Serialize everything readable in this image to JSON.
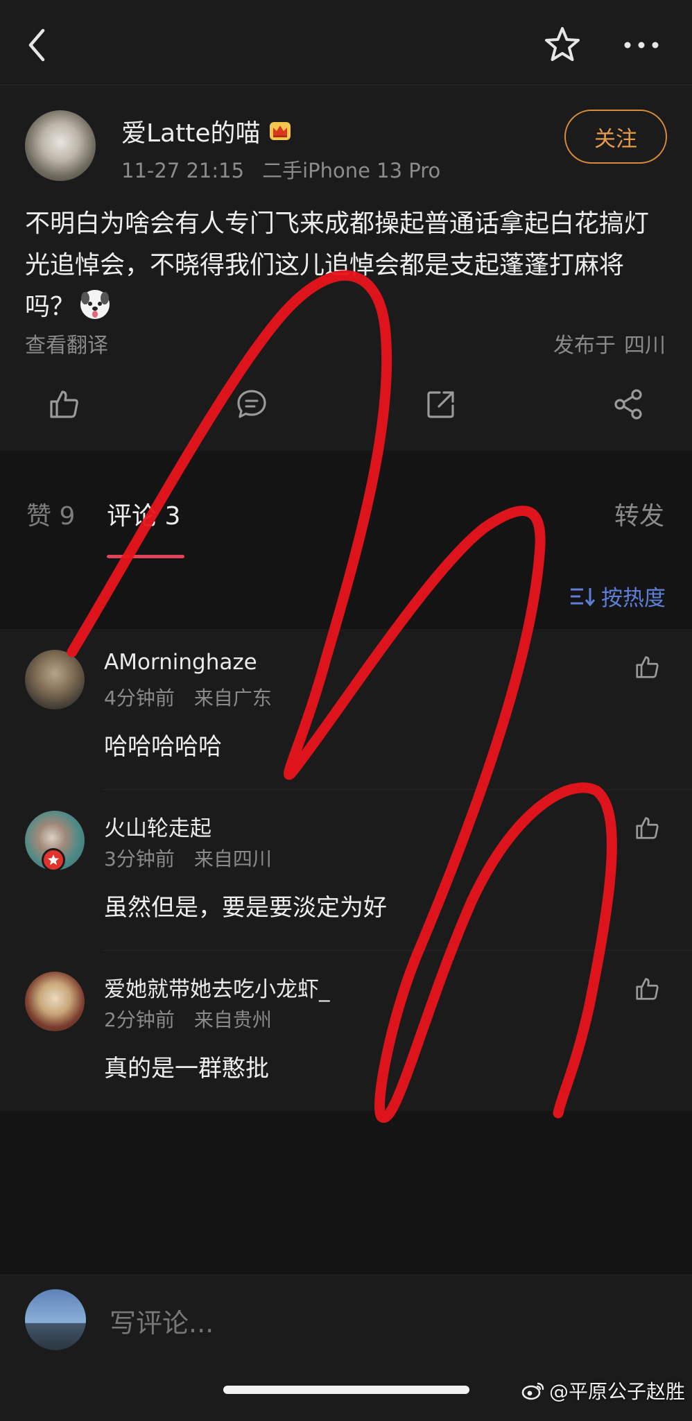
{
  "post": {
    "username": "爱Latte的喵",
    "time": "11-27 21:15",
    "device": "二手iPhone 13 Pro",
    "follow_label": "关注",
    "text": "不明白为啥会有人专门飞来成都操起普通话拿起白花搞灯光追悼会，不晓得我们这儿追悼会都是支起蓬蓬打麻将吗？",
    "translate_label": "查看翻译",
    "location_prefix": "发布于",
    "location": "四川"
  },
  "tabs": {
    "likes": "赞 9",
    "comments": "评论 3",
    "reposts": "转发",
    "sort_label": "按热度"
  },
  "comments": [
    {
      "name": "AMorninghaze",
      "time": "4分钟前",
      "from": "来自广东",
      "text": "哈哈哈哈哈"
    },
    {
      "name": "火山轮走起",
      "time": "3分钟前",
      "from": "来自四川",
      "text": "虽然但是，要是要淡定为好"
    },
    {
      "name": "爱她就带她去吃小龙虾_",
      "time": "2分钟前",
      "from": "来自贵州",
      "text": "真的是一群憨批"
    }
  ],
  "input": {
    "placeholder": "写评论..."
  },
  "watermark": "@平原公子赵胜",
  "colors": {
    "accent_follow": "#e79a4a",
    "tab_underline": "#e0425a",
    "sort_blue": "#5d7fd8",
    "annotation_red": "#e8141c"
  },
  "icons": [
    "back-icon",
    "star-icon",
    "more-icon",
    "crown-icon",
    "dog-emoji-icon",
    "like-icon",
    "comment-icon",
    "repost-icon",
    "share-icon",
    "sort-icon",
    "weibo-logo-icon"
  ]
}
